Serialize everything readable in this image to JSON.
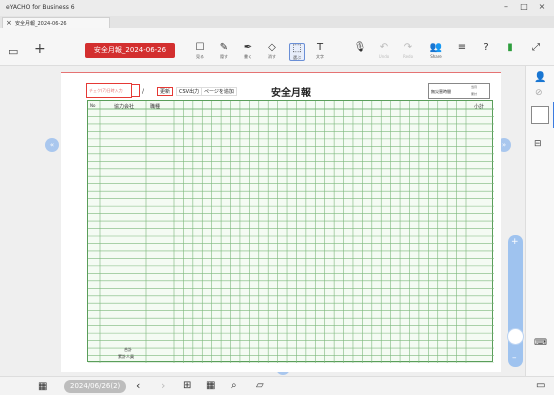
{
  "app": {
    "title": "eYACHO for Business 6"
  },
  "window_controls": {
    "minimize": "–",
    "maximize": "□",
    "close": "×"
  },
  "tab": {
    "label": "安全月報_2024-06-26",
    "close": "×"
  },
  "toolbar": {
    "date_label": "安全月報_2024-06-26",
    "tools": [
      {
        "name": "view",
        "caption": "見る",
        "glyph": "☐"
      },
      {
        "name": "hide",
        "caption": "隠す",
        "glyph": "✎"
      },
      {
        "name": "write",
        "caption": "書く",
        "glyph": "✒"
      },
      {
        "name": "erase",
        "caption": "消す",
        "glyph": "◇"
      },
      {
        "name": "select",
        "caption": "選ぶ",
        "glyph": "⬚"
      },
      {
        "name": "text",
        "caption": "文字",
        "glyph": "T"
      },
      {
        "name": "mic",
        "caption": "",
        "glyph": "🎙"
      },
      {
        "name": "undo",
        "caption": "Undo",
        "glyph": "↶"
      },
      {
        "name": "redo",
        "caption": "Redo",
        "glyph": "↷"
      },
      {
        "name": "share",
        "caption": "Share",
        "glyph": "👥"
      },
      {
        "name": "menu",
        "caption": "",
        "glyph": "≡"
      },
      {
        "name": "help",
        "caption": "",
        "glyph": "?"
      },
      {
        "name": "battery",
        "caption": "",
        "glyph": "▮"
      },
      {
        "name": "expand",
        "caption": "",
        "glyph": "⤢"
      }
    ]
  },
  "sheet": {
    "title": "安全月報",
    "input_placeholder": "チェク(7)日時入力",
    "slash": "/",
    "buttons": {
      "update": "更新",
      "csv": "CSV出力",
      "add_page": "ページを追加"
    },
    "no_accident_label": "無災害時間",
    "no_accident_sub": [
      "当月",
      "累計"
    ],
    "columns": {
      "no": "No",
      "company": "協力会社",
      "job": "職種",
      "subtotal": "小計"
    },
    "footer": {
      "total": "合計",
      "cumulative": "累計人員"
    }
  },
  "bottombar": {
    "date": "2024/06/26(2)",
    "prev": "‹",
    "next": "›"
  },
  "colors": {
    "accent_red": "#d32f2f",
    "grid_green": "#5a9e5a",
    "nav_blue": "#a9c7ee"
  }
}
